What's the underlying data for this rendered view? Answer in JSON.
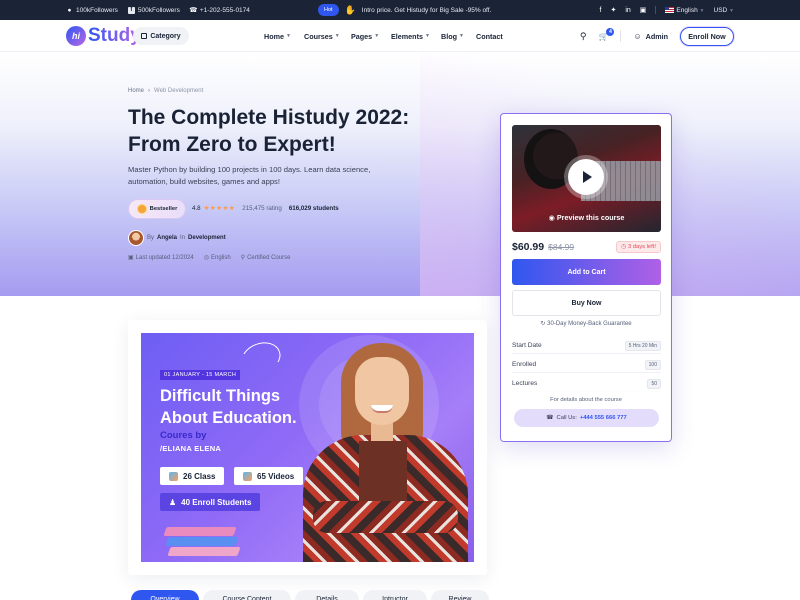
{
  "topbar": {
    "followers_1": "100kFollowers",
    "followers_2": "500kFollowers",
    "phone": "+1-202-555-0174",
    "hot_label": "Hot",
    "promo": "Intro price. Get Histudy for Big Sale -95% off.",
    "language": "English",
    "currency": "USD"
  },
  "header": {
    "logo_mark": "hi",
    "logo_text": "Study",
    "category": "Category",
    "nav": [
      "Home",
      "Courses",
      "Pages",
      "Elements",
      "Blog",
      "Contact"
    ],
    "cart_count": "4",
    "admin": "Admin",
    "enroll": "Enroll Now"
  },
  "hero": {
    "breadcrumb_home": "Home",
    "breadcrumb_current": "Web Development",
    "title": "The Complete Histudy 2022: From Zero to Expert!",
    "description": "Master Python by building 100 projects in 100 days. Learn data science, automation, build websites, games and apps!",
    "badge": "Bestseller",
    "rating_value": "4.8",
    "rating_count": "215,475 rating",
    "students": "616,029 students",
    "author_prefix": "By",
    "author_name": "Angela",
    "author_in": "In",
    "author_category": "Development",
    "last_updated": "Last updated 12/2024",
    "language": "English",
    "certified": "Certified Course"
  },
  "sidebar": {
    "preview_label": "Preview this course",
    "price": "$60.99",
    "old_price": "$84.99",
    "days_left": "3 days left!",
    "add_to_cart": "Add to Cart",
    "buy_now": "Buy Now",
    "guarantee": "30-Day Money-Back Guarantee",
    "info": [
      {
        "label": "Start Date",
        "value": "5 Hrs 20 Min"
      },
      {
        "label": "Enrolled",
        "value": "100"
      },
      {
        "label": "Lectures",
        "value": "50"
      }
    ],
    "details_text": "For details about the course",
    "call_prefix": "Call Us:",
    "call_number": "+444 555 666 777"
  },
  "banner": {
    "date_range": "01 JANUARY - 15 MARCH",
    "title": "Difficult Things About Education.",
    "by": "Coures by",
    "instructor": "/ELIANA ELENA",
    "class_count": "26 Class",
    "video_count": "65 Videos",
    "enroll_count": "40 Enroll Students"
  },
  "tabs": [
    "Overview",
    "Course Content",
    "Details",
    "Intructor",
    "Review"
  ],
  "colors": {
    "primary": "#2f57ef",
    "secondary": "#b966e7",
    "dark": "#1b2437",
    "star": "#ff9747",
    "danger": "#e34a56"
  }
}
